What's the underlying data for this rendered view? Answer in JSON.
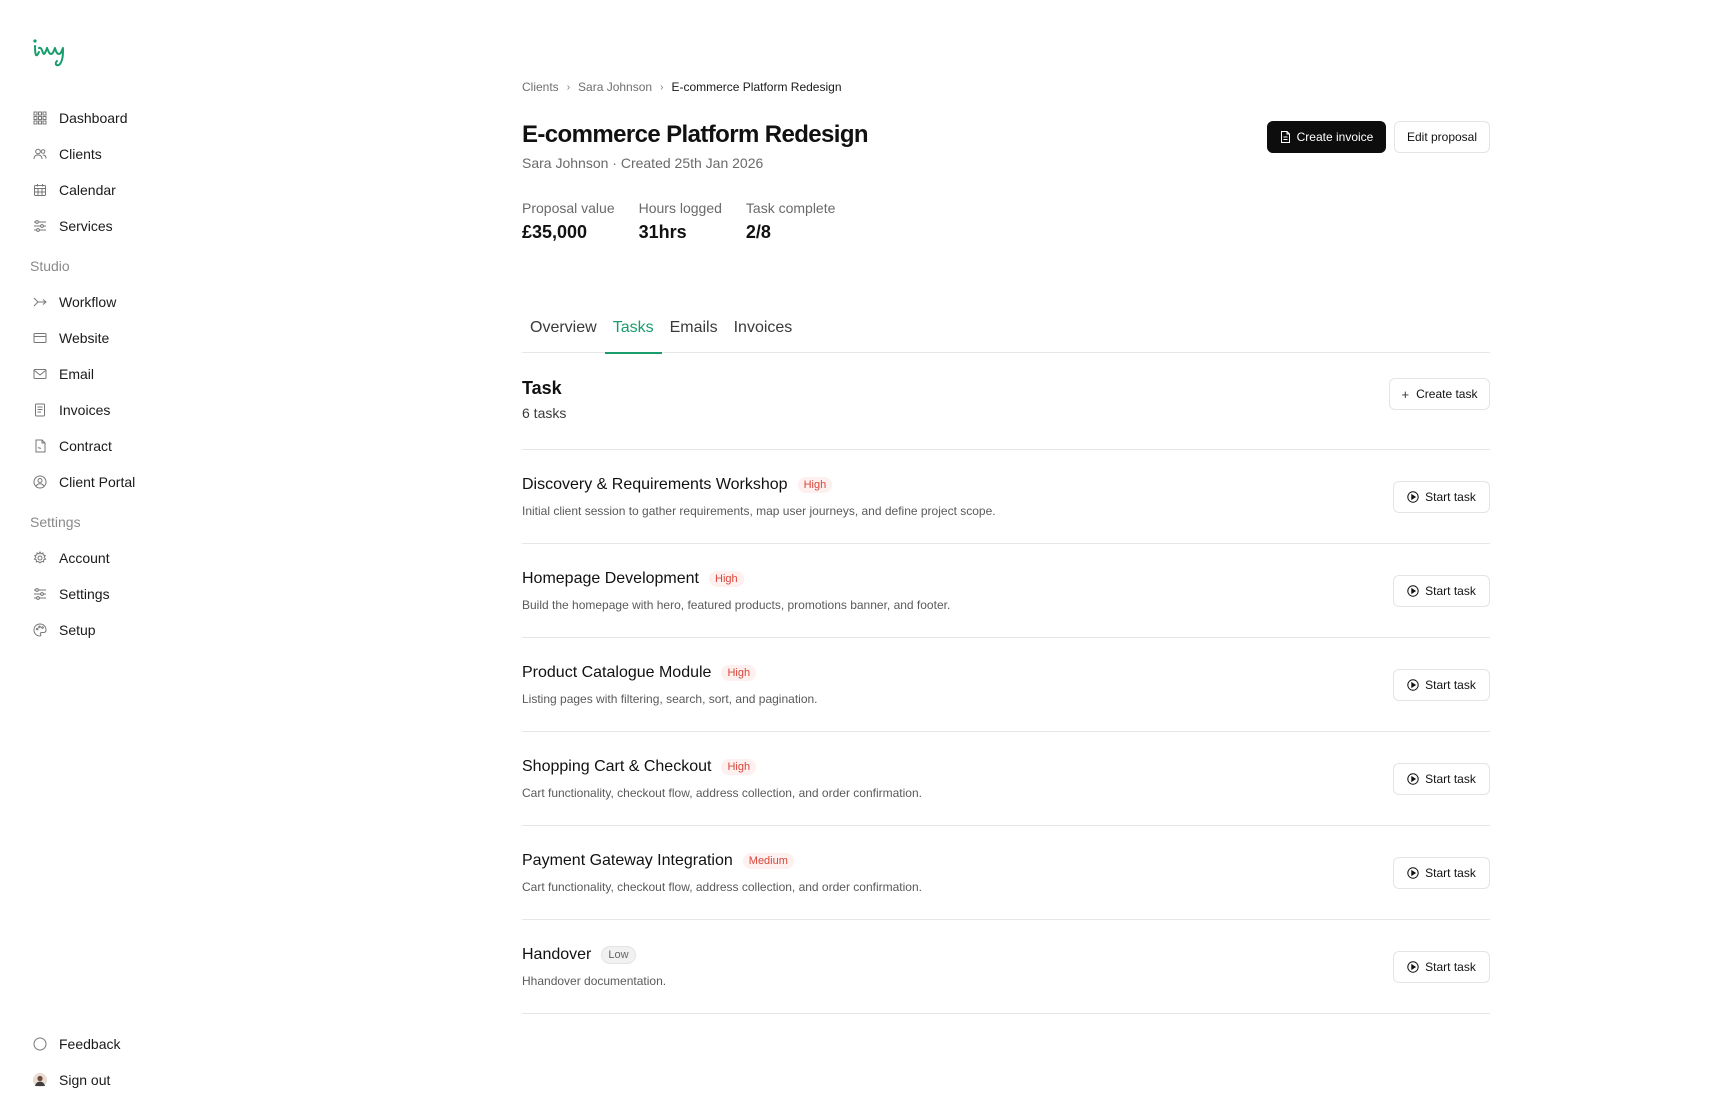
{
  "brand": {
    "logo_text": "ivy",
    "accent": "#1a9d6c"
  },
  "sidebar": {
    "main_items": [
      {
        "label": "Dashboard",
        "icon": "grid-icon"
      },
      {
        "label": "Clients",
        "icon": "users-icon"
      },
      {
        "label": "Calendar",
        "icon": "calendar-icon"
      },
      {
        "label": "Services",
        "icon": "sliders-icon"
      }
    ],
    "studio_label": "Studio",
    "studio_items": [
      {
        "label": "Workflow",
        "icon": "workflow-icon"
      },
      {
        "label": "Website",
        "icon": "browser-icon"
      },
      {
        "label": "Email",
        "icon": "mail-icon"
      },
      {
        "label": "Invoices",
        "icon": "receipt-icon"
      },
      {
        "label": "Contract",
        "icon": "document-icon"
      },
      {
        "label": "Client Portal",
        "icon": "user-circle-icon"
      }
    ],
    "settings_label": "Settings",
    "settings_items": [
      {
        "label": "Account",
        "icon": "gear-icon"
      },
      {
        "label": "Settings",
        "icon": "sliders-icon"
      },
      {
        "label": "Setup",
        "icon": "palette-icon"
      }
    ],
    "bottom_items": [
      {
        "label": "Feedback",
        "icon": "circle-icon"
      },
      {
        "label": "Sign out",
        "icon": "avatar-icon"
      }
    ]
  },
  "breadcrumb": {
    "items": [
      "Clients",
      "Sara Johnson",
      "E-commerce Platform Redesign"
    ]
  },
  "header": {
    "title": "E-commerce Platform Redesign",
    "subtitle": "Sara Johnson · Created 25th Jan 2026",
    "create_invoice_label": "Create invoice",
    "edit_proposal_label": "Edit proposal"
  },
  "stats": [
    {
      "label": "Proposal value",
      "value": "£35,000"
    },
    {
      "label": "Hours logged",
      "value": "31hrs"
    },
    {
      "label": "Task complete",
      "value": "2/8"
    }
  ],
  "tabs": [
    {
      "label": "Overview",
      "active": false
    },
    {
      "label": "Tasks",
      "active": true
    },
    {
      "label": "Emails",
      "active": false
    },
    {
      "label": "Invoices",
      "active": false
    }
  ],
  "tasks_section": {
    "title": "Task",
    "count": "6 tasks",
    "create_label": "Create task",
    "start_label": "Start task"
  },
  "tasks": [
    {
      "name": "Discovery & Requirements Workshop",
      "priority": "High",
      "level": "high",
      "description": "Initial client session to gather requirements, map user journeys, and define project scope."
    },
    {
      "name": "Homepage Development",
      "priority": "High",
      "level": "high",
      "description": "Build the homepage with hero, featured products, promotions banner, and footer."
    },
    {
      "name": "Product Catalogue Module",
      "priority": "High",
      "level": "high",
      "description": "Listing pages with filtering, search, sort, and pagination."
    },
    {
      "name": "Shopping Cart & Checkout",
      "priority": "High",
      "level": "high",
      "description": "Cart functionality, checkout flow, address collection, and order confirmation."
    },
    {
      "name": "Payment Gateway Integration",
      "priority": "Medium",
      "level": "medium",
      "description": "Cart functionality, checkout flow, address collection, and order confirmation."
    },
    {
      "name": "Handover",
      "priority": "Low",
      "level": "low",
      "description": "Hhandover documentation."
    }
  ]
}
